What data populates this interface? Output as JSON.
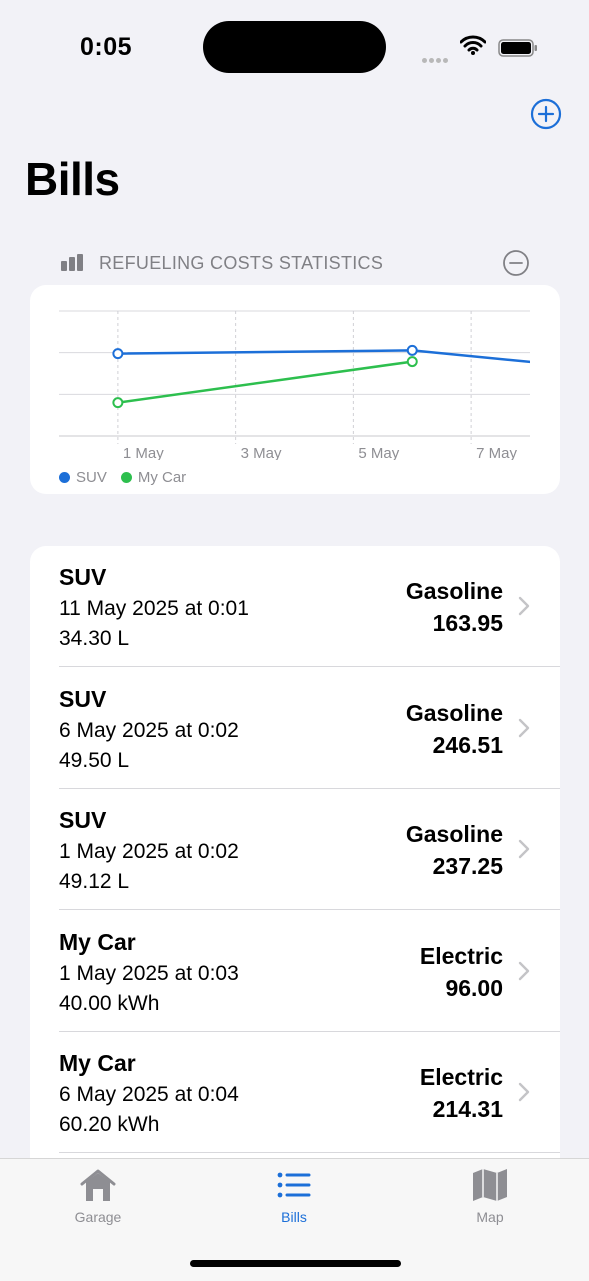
{
  "status_bar": {
    "time": "0:05"
  },
  "header": {
    "title": "Bills"
  },
  "statistics": {
    "label": "REFUELING COSTS STATISTICS",
    "legend": [
      {
        "name": "SUV",
        "color": "#1c6fd8"
      },
      {
        "name": "My Car",
        "color": "#2dbf4e"
      }
    ]
  },
  "chart_data": {
    "type": "line",
    "x_tick_labels": [
      "1 May",
      "3 May",
      "5 May",
      "7 May"
    ],
    "series": [
      {
        "name": "SUV",
        "color": "#1c6fd8",
        "points": [
          {
            "x": "2025-05-01",
            "y": 237.25
          },
          {
            "x": "2025-05-06",
            "y": 246.51
          },
          {
            "x": "2025-05-11",
            "y": 163.95
          }
        ]
      },
      {
        "name": "My Car",
        "color": "#2dbf4e",
        "points": [
          {
            "x": "2025-05-01",
            "y": 96.0
          },
          {
            "x": "2025-05-06",
            "y": 214.31
          }
        ]
      }
    ],
    "xlim": [
      "2025-04-30",
      "2025-05-08"
    ],
    "ylim": [
      0,
      360
    ],
    "grid": true
  },
  "bills": [
    {
      "vehicle": "SUV",
      "date": "11 May 2025 at 0:01",
      "amount": "34.30 L",
      "fuel": "Gasoline",
      "cost": "163.95"
    },
    {
      "vehicle": "SUV",
      "date": "6 May 2025 at 0:02",
      "amount": "49.50 L",
      "fuel": "Gasoline",
      "cost": "246.51"
    },
    {
      "vehicle": "SUV",
      "date": "1 May 2025 at 0:02",
      "amount": "49.12 L",
      "fuel": "Gasoline",
      "cost": "237.25"
    },
    {
      "vehicle": "My Car",
      "date": "1 May 2025 at 0:03",
      "amount": "40.00 kWh",
      "fuel": "Electric",
      "cost": "96.00"
    },
    {
      "vehicle": "My Car",
      "date": "6 May 2025 at 0:04",
      "amount": "60.20 kWh",
      "fuel": "Electric",
      "cost": "214.31"
    }
  ],
  "tab_bar": {
    "tabs": [
      {
        "label": "Garage",
        "icon": "house-icon",
        "active": false
      },
      {
        "label": "Bills",
        "icon": "list-icon",
        "active": true
      },
      {
        "label": "Map",
        "icon": "map-icon",
        "active": false
      }
    ]
  },
  "colors": {
    "accent": "#1c6fd8",
    "inactive": "#8e8e93",
    "background": "#f2f2f7"
  }
}
